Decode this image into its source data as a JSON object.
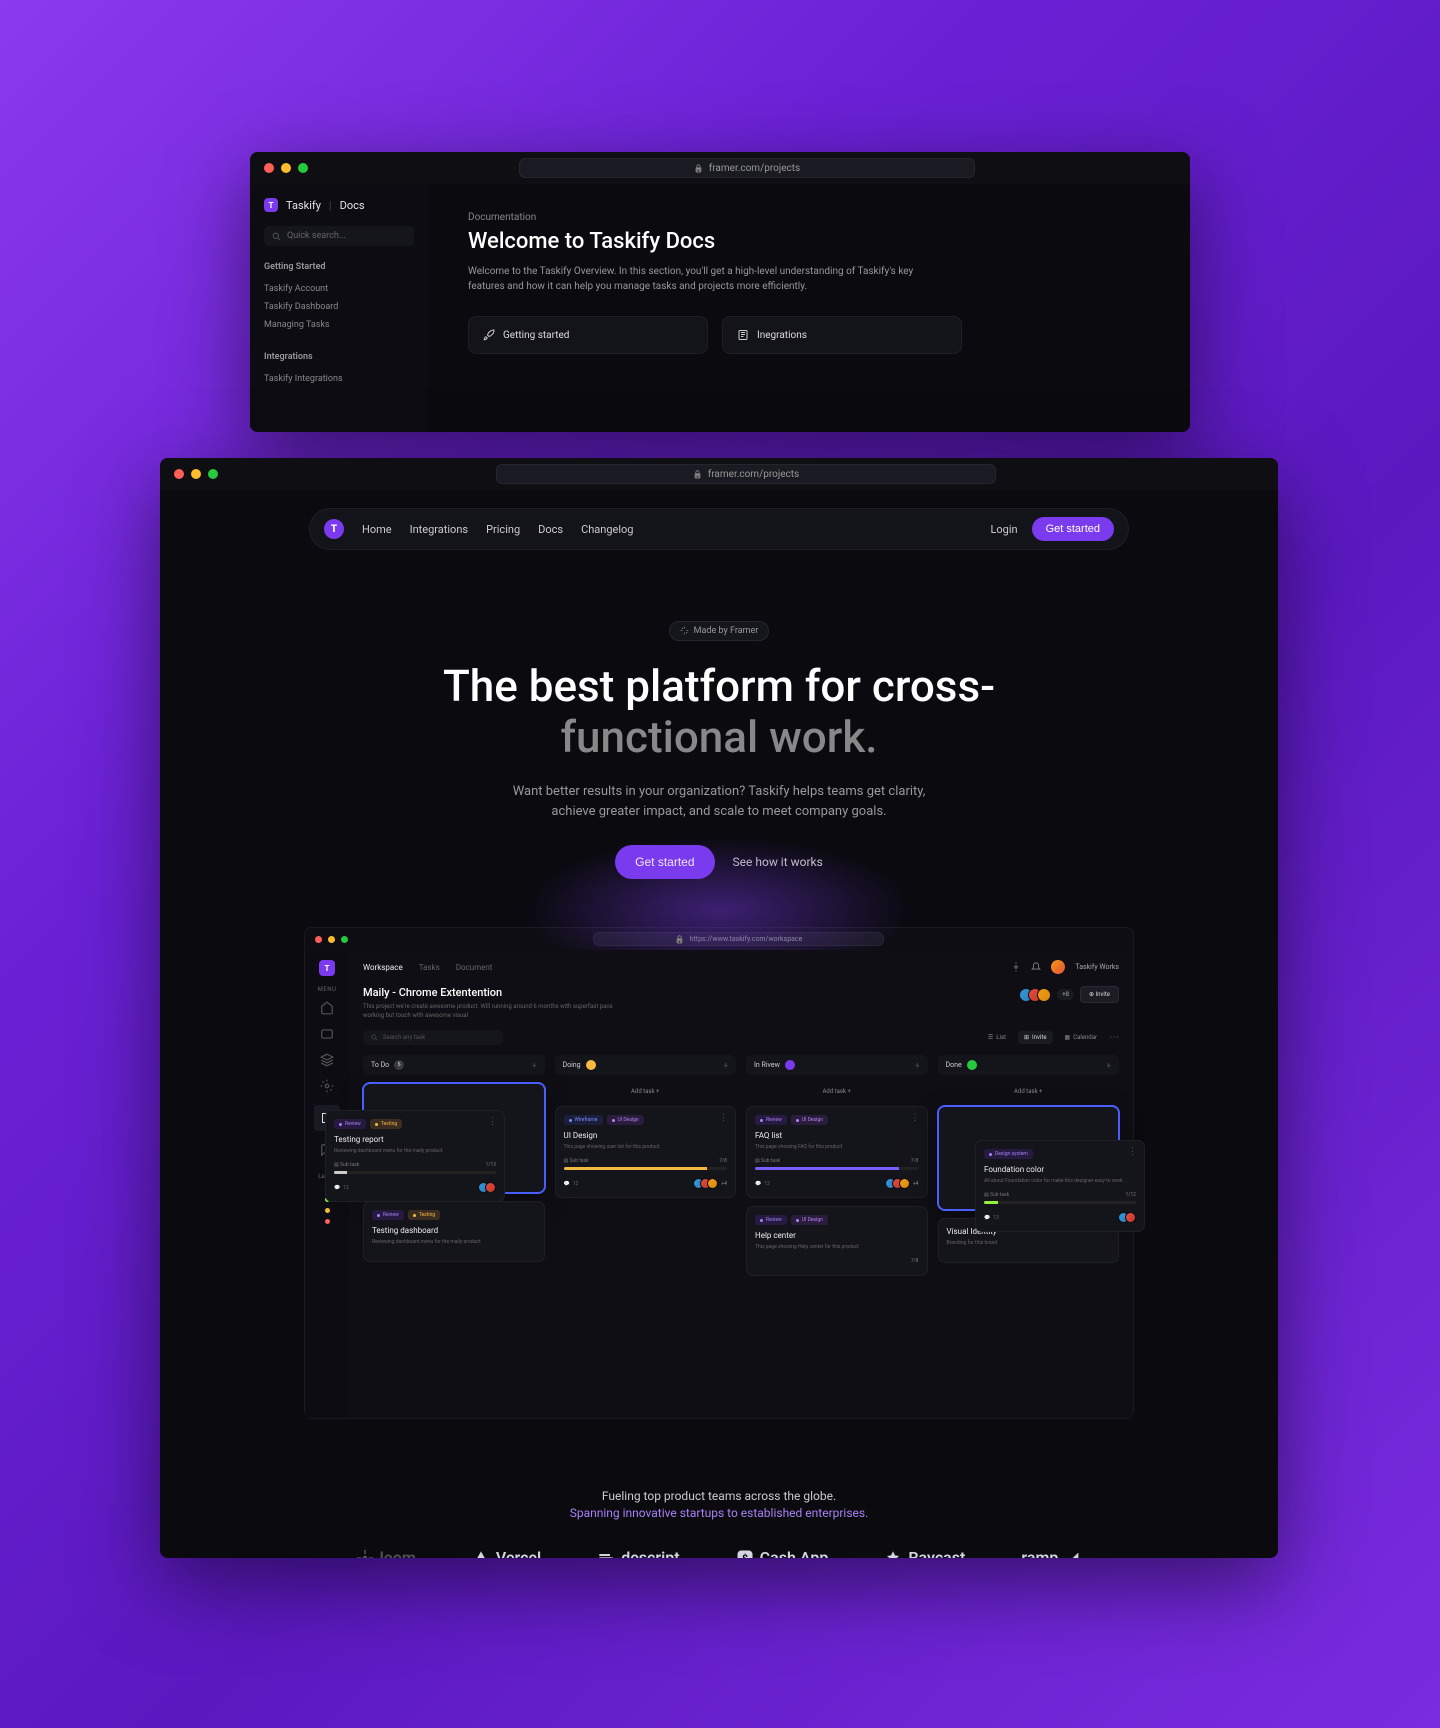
{
  "back_window": {
    "url": "framer.com/projects",
    "brand": "Taskify",
    "docs_label": "Docs",
    "search_placeholder": "Quick search...",
    "sections": [
      {
        "title": "Getting Started",
        "links": [
          "Taskify Account",
          "Taskify Dashboard",
          "Managing Tasks"
        ]
      },
      {
        "title": "Integrations",
        "links": [
          "Taskify Integrations"
        ]
      }
    ],
    "eyebrow": "Documentation",
    "h1": "Welcome to Taskify Docs",
    "description": "Welcome to the Taskify Overview. In this section, you'll get a high-level understanding of Taskify's key features and how it can help you manage tasks and projects more efficiently.",
    "cards": [
      {
        "icon": "rocket",
        "label": "Getting started"
      },
      {
        "icon": "book",
        "label": "Inegrations"
      }
    ]
  },
  "front_window": {
    "url": "framer.com/projects",
    "nav": [
      "Home",
      "Integrations",
      "Pricing",
      "Docs",
      "Changelog"
    ],
    "login": "Login",
    "cta": "Get started",
    "badge": "Made by Framer",
    "hero_line1": "The best platform for cross-",
    "hero_line2": "functional work.",
    "hero_desc": "Want better results in your organization? Taskify helps teams get clarity, achieve greater impact, and scale to meet company goals.",
    "hero_cta": "Get started",
    "hero_secondary": "See how it works"
  },
  "inner_app": {
    "url": "https://www.taskify.com/workspace",
    "rail_menu_label": "MENU",
    "rail_labels_label": "Labels",
    "label_colors": [
      "#a881f5",
      "#7aef3a",
      "#f5b942",
      "#ff5f56"
    ],
    "tabs": [
      "Workspace",
      "Tasks",
      "Document"
    ],
    "workspace_name": "Taskify Works",
    "title": "Maily - Chrome Extentention",
    "subtitle": "This project we're create awesome product. Will running around 6 months with superfast pace working but touch with awesome visual",
    "members_extra": "+8",
    "invite": "Invite",
    "search_placeholder": "Search any task",
    "views": {
      "list": "List",
      "invite": "Invite",
      "calendar": "Calendar"
    },
    "columns": [
      {
        "name": "To Do",
        "count": "5",
        "color": "gray"
      },
      {
        "name": "Doing",
        "count": "",
        "color": "yellow"
      },
      {
        "name": "In Rivew",
        "count": "",
        "color": "purple"
      },
      {
        "name": "Done",
        "count": "",
        "color": "green"
      }
    ],
    "add_task": "Add task",
    "cards": {
      "testing_report": {
        "tags": [
          [
            "Review",
            "purple"
          ],
          [
            "Testing",
            "orange"
          ]
        ],
        "title": "Testing report",
        "desc": "Reviewing dashboard menu for the maily product",
        "subtask": "Sub task",
        "progress_label": "1/13",
        "progress_pct": 8,
        "comments": "12"
      },
      "testing_dashboard": {
        "tags": [
          [
            "Review",
            "purple"
          ],
          [
            "Testing",
            "orange"
          ]
        ],
        "title": "Testing dashboard",
        "desc": "Reviewing dashboard menu for the maily product"
      },
      "ui_design": {
        "tags": [
          [
            "Wireframe",
            "blue"
          ],
          [
            "UI Design",
            "violet"
          ]
        ],
        "title": "UI Design",
        "desc": "This page showing user list for this product",
        "subtask": "Sub task",
        "progress_label": "7/8",
        "progress_pct": 88,
        "comments": "12",
        "extra": "+4"
      },
      "faq": {
        "tags": [
          [
            "Review",
            "purple"
          ],
          [
            "UI Design",
            "violet"
          ]
        ],
        "title": "FAQ list",
        "desc": "This page showing FAQ for this product",
        "subtask": "Sub task",
        "progress_label": "7/8",
        "progress_pct": 88,
        "comments": "12",
        "extra": "+4"
      },
      "help": {
        "tags": [
          [
            "Review",
            "purple"
          ],
          [
            "UI Design",
            "violet"
          ]
        ],
        "title": "Help center",
        "desc": "This page showing Help center for this product",
        "progress_label": "7/8"
      },
      "foundation": {
        "tags": [
          [
            "Design system",
            "purple"
          ]
        ],
        "title": "Foundation color",
        "desc": "All about Foundation color for make this designer easy to work",
        "subtask": "Sub task",
        "progress_label": "1/12",
        "progress_pct": 9,
        "comments": "13"
      },
      "visual": {
        "title": "Visual Identity",
        "desc": "Branding for this brand"
      }
    }
  },
  "proof": {
    "line1": "Fueling top product teams across the globe.",
    "line2": "Spanning innovative startups to established enterprises.",
    "logos": [
      "loom",
      "Vercel",
      "descript",
      "Cash App",
      "Raycast",
      "ramp"
    ]
  }
}
